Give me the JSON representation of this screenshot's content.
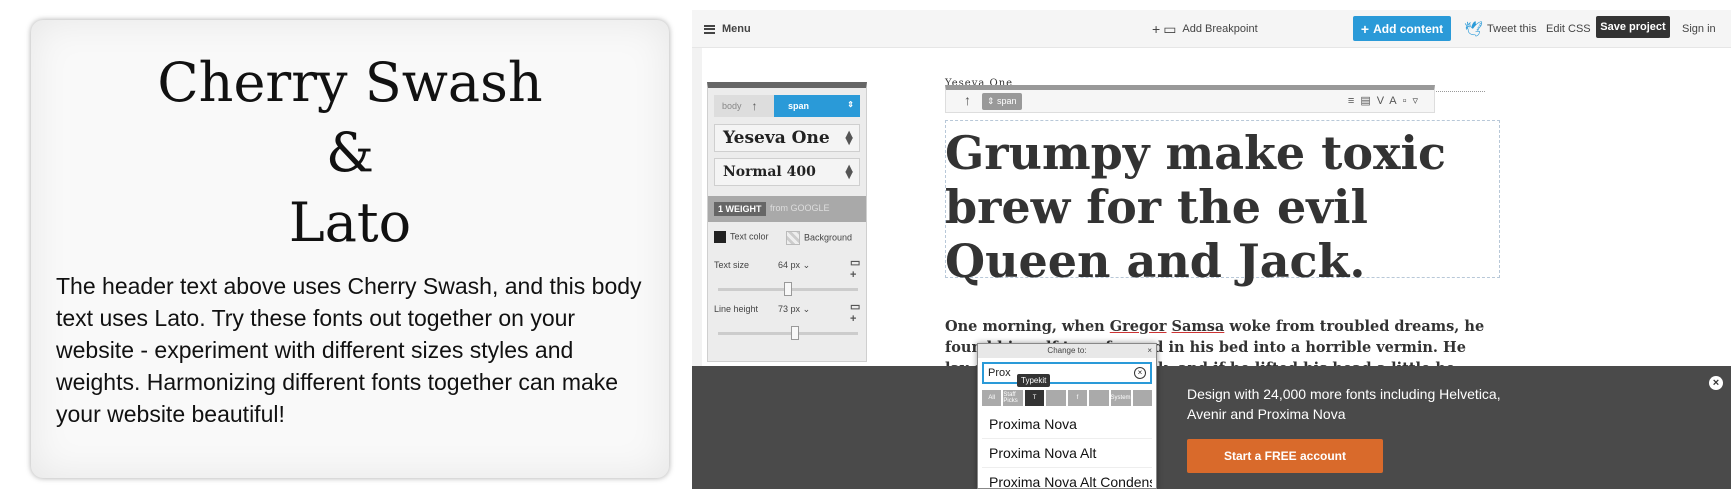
{
  "left_card": {
    "title_line1": "Cherry Swash",
    "title_line2": "&",
    "title_line3": "Lato",
    "body": "The header text above uses Cherry Swash, and this body text uses Lato. Try these fonts out together on your website - experiment with different sizes styles and weights. Harmonizing different fonts together can make your website beautiful!"
  },
  "topbar": {
    "menu_label": "Menu",
    "breakpoint_label": "Add Breakpoint",
    "add_content_label": "Add content",
    "tweet_label": "Tweet this",
    "edit_css_label": "Edit CSS",
    "save_label": "Save project",
    "signin_label": "Sign in"
  },
  "panel": {
    "crumb_body": "body",
    "crumb_span": "span",
    "font_family": "Yeseva One",
    "font_weight": "Normal 400",
    "weight_badge": "1 WEIGHT",
    "weight_source": "from GOOGLE",
    "text_color_label": "Text color",
    "background_label": "Background",
    "text_size_label": "Text size",
    "text_size_value": "64",
    "text_size_unit": "px",
    "text_size_level": 0.5,
    "line_height_label": "Line height",
    "line_height_value": "73",
    "line_height_unit": "px",
    "line_height_level": 0.55
  },
  "canvas": {
    "font_tag": "Yeseva One",
    "toolbar_tag": "span",
    "headline": "Grumpy make toxic brew for the evil Queen and Jack.",
    "paragraph_pre": "One morning, when ",
    "paragraph_u1": "Gregor",
    "paragraph_mid": " ",
    "paragraph_u2": "Samsa",
    "paragraph_post": " woke from troubled dreams, he found himself transformed in his bed into a horrible vermin. He lay on his armour-like back, and if he lifted his head a little he"
  },
  "popup": {
    "title": "Change to:",
    "search_value": "Prox",
    "tooltip": "Typekit",
    "tabs": [
      "All",
      "Staff Picks",
      "T",
      "",
      "f",
      "",
      "System",
      ""
    ],
    "results": [
      "Proxima Nova",
      "Proxima Nova Alt",
      "Proxima Nova Alt Condensed"
    ]
  },
  "promo": {
    "text": "Design with 24,000 more fonts including Helvetica, Avenir and Proxima Nova",
    "button_label": "Start a FREE account"
  },
  "colors": {
    "accent": "#2a9ad8",
    "cta": "#d96a2b",
    "promo_bg": "#4a4a4a"
  }
}
